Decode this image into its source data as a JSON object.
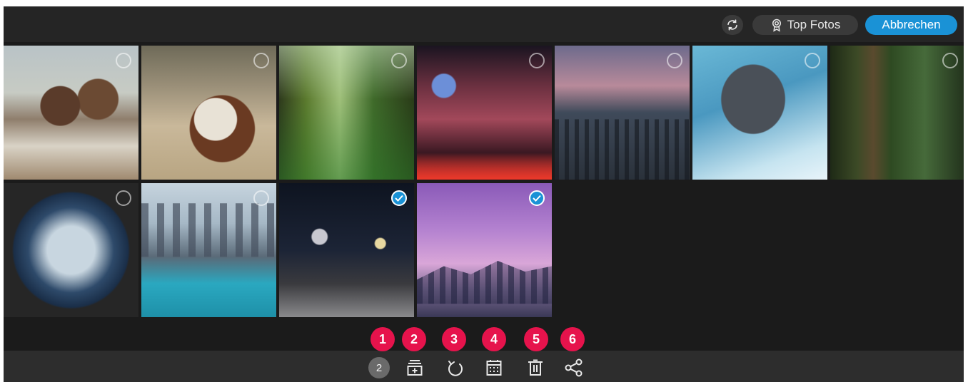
{
  "header": {
    "refresh_icon": "refresh-icon",
    "top_fotos_label": "Top Fotos",
    "top_fotos_icon": "award-icon",
    "cancel_label": "Abbrechen"
  },
  "colors": {
    "accent": "#1a92d6",
    "badge": "#e6134c"
  },
  "photos": [
    {
      "subject": "couple-beach",
      "selected": false
    },
    {
      "subject": "goat",
      "selected": false
    },
    {
      "subject": "forest-trees",
      "selected": false
    },
    {
      "subject": "times-square-night",
      "selected": false
    },
    {
      "subject": "new-york-skyline-dusk",
      "selected": false
    },
    {
      "subject": "dolphin",
      "selected": false
    },
    {
      "subject": "dragonfly",
      "selected": false
    },
    {
      "subject": "ocean-porthole",
      "selected": false
    },
    {
      "subject": "dubai-marina-boat",
      "selected": false
    },
    {
      "subject": "waterfront-night",
      "selected": true
    },
    {
      "subject": "skyline-purple-sky",
      "selected": true
    }
  ],
  "bottom_bar": {
    "selected_count": "2",
    "tools": [
      {
        "name": "add-to-album-icon"
      },
      {
        "name": "rotate-icon"
      },
      {
        "name": "calendar-icon"
      },
      {
        "name": "delete-icon"
      },
      {
        "name": "share-icon"
      }
    ],
    "badges": [
      "1",
      "2",
      "3",
      "4",
      "5",
      "6"
    ]
  }
}
